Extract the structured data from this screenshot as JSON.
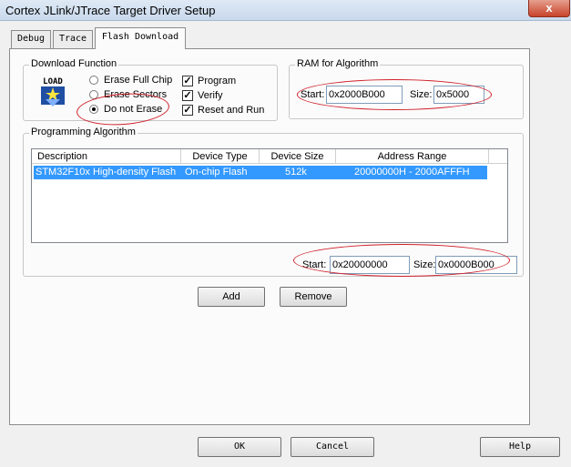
{
  "window": {
    "title": "Cortex JLink/JTrace Target Driver Setup",
    "close_glyph": "x"
  },
  "tabs": [
    {
      "label": "Debug"
    },
    {
      "label": "Trace"
    },
    {
      "label": "Flash Download"
    }
  ],
  "download_function": {
    "group_label": "Download Function",
    "icon_text": "LOAD",
    "radios": [
      {
        "label": "Erase Full Chip",
        "selected": false
      },
      {
        "label": "Erase Sectors",
        "selected": false
      },
      {
        "label": "Do not Erase",
        "selected": true
      }
    ],
    "checkboxes": [
      {
        "label": "Program",
        "checked": true
      },
      {
        "label": "Verify",
        "checked": true
      },
      {
        "label": "Reset and Run",
        "checked": true
      }
    ]
  },
  "ram_for_algorithm": {
    "group_label": "RAM for Algorithm",
    "start_label": "Start:",
    "start_value": "0x2000B000",
    "size_label": "Size:",
    "size_value": "0x5000"
  },
  "programming_algorithm": {
    "group_label": "Programming Algorithm",
    "columns": [
      "Description",
      "Device Type",
      "Device Size",
      "Address Range"
    ],
    "rows": [
      {
        "description": "STM32F10x High-density Flash",
        "device_type": "On-chip Flash",
        "device_size": "512k",
        "address_range": "20000000H - 2000AFFFH"
      }
    ],
    "start_label": "Start:",
    "start_value": "0x20000000",
    "size_label": "Size:",
    "size_value": "0x0000B000"
  },
  "actions": {
    "add_label": "Add",
    "remove_label": "Remove"
  },
  "footer": {
    "ok_label": "OK",
    "cancel_label": "Cancel",
    "help_label": "Help"
  },
  "colors": {
    "selection": "#3399ff",
    "annotation": "#d0202a",
    "tab_panel": "#fbfbfb"
  }
}
